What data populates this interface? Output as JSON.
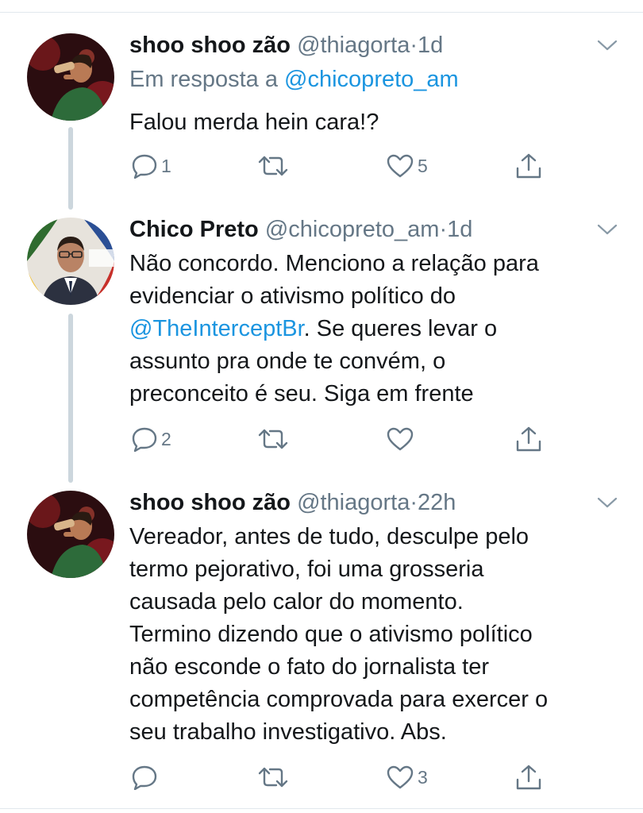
{
  "colors": {
    "link": "#1b95e0",
    "secondary": "#657786",
    "text": "#14171a",
    "thread_line": "#ccd6dd"
  },
  "tweets": [
    {
      "name": "shoo shoo zão",
      "handle": "@thiagorta",
      "dot": "·",
      "time": "1d",
      "reply_prefix": "Em resposta a",
      "reply_to": "@chicopreto_am",
      "lines": [
        "Falou merda hein cara!?"
      ],
      "reply_count": "1",
      "like_count": "5",
      "avatar_icon": "profile-photo-performer-icon"
    },
    {
      "name": "Chico Preto",
      "handle": "@chicopreto_am",
      "dot": "·",
      "time": "1d",
      "line1": "Não concordo. Menciono a relação para",
      "line2": "evidenciar o ativismo político do",
      "mention": "@TheInterceptBr",
      "line3_rest": ". Se queres levar o",
      "line4": "assunto pra onde te convém, o",
      "line5": "preconceito é seu. Siga em frente",
      "reply_count": "2",
      "like_count": "",
      "avatar_icon": "profile-photo-man-suit-icon"
    },
    {
      "name": "shoo shoo zão",
      "handle": "@thiagorta",
      "dot": "·",
      "time": "22h",
      "lines": [
        "Vereador, antes de tudo, desculpe pelo",
        "termo pejorativo, foi uma grosseria",
        "causada pelo calor do momento.",
        "Termino dizendo que o ativismo político",
        "não esconde o fato do jornalista ter",
        "competência comprovada para exercer o",
        "seu trabalho investigativo. Abs."
      ],
      "reply_count": "",
      "like_count": "3",
      "avatar_icon": "profile-photo-performer-icon"
    }
  ]
}
